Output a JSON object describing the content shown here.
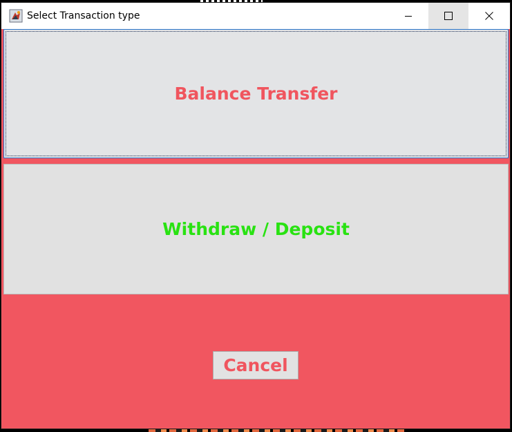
{
  "window": {
    "title": "Select Transaction type",
    "minimize_icon": "minimize-icon",
    "maximize_icon": "maximize-icon",
    "close_icon": "close-icon"
  },
  "buttons": {
    "balance_transfer": "Balance Transfer",
    "withdraw_deposit": "Withdraw / Deposit",
    "cancel": "Cancel"
  },
  "colors": {
    "panel_background": "#f15660",
    "balance_text": "#f0555e",
    "withdraw_text": "#29e212",
    "cancel_text": "#f0555e",
    "button_face": "#e3e4e6"
  }
}
